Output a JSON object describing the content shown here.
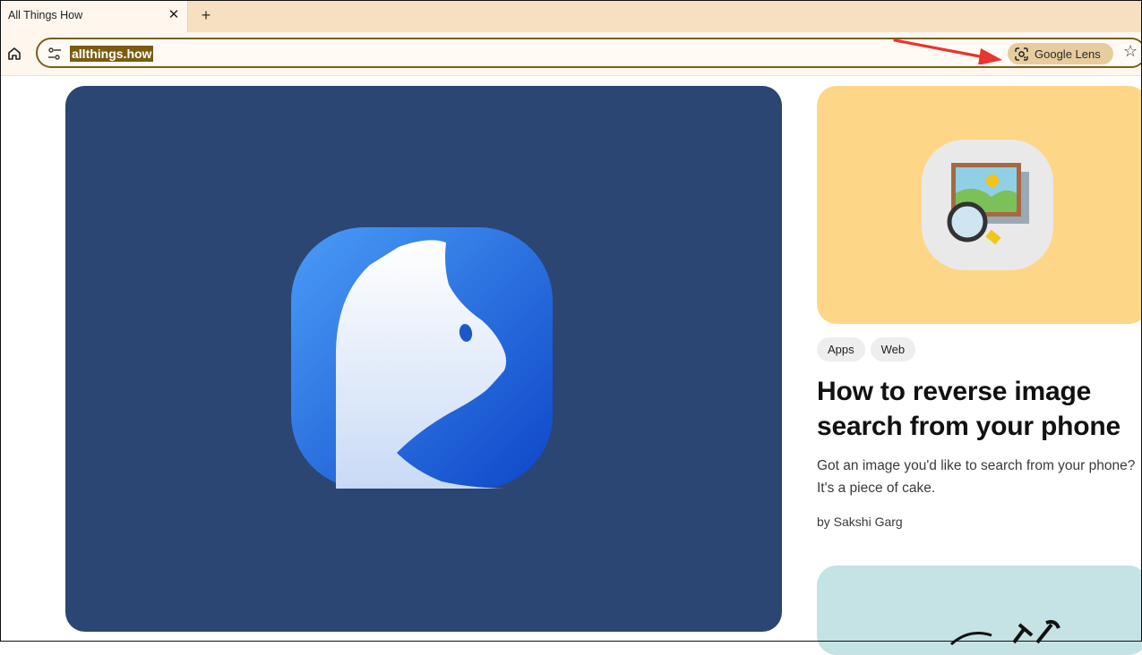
{
  "browser": {
    "tab_title": "All Things How",
    "tab_close": "✕",
    "new_tab": "+",
    "url": "allthings.how",
    "lens_label": "Google Lens",
    "star": "☆"
  },
  "hero": {
    "icon": "cat-app-icon"
  },
  "article": {
    "tags": [
      "Apps",
      "Web"
    ],
    "title": "How to reverse image search from your phone",
    "excerpt": "Got an image you'd like to search from your phone? It's a piece of cake.",
    "byline": "by Sakshi Garg"
  },
  "colors": {
    "tab_strip": "#f7e0c2",
    "omnibox_border": "#7c5e1e",
    "lens_chip": "#e7cc9e",
    "hero_bg": "#2b4673",
    "card_bg": "#fed687",
    "card2_bg": "#c5e2e4",
    "arrow": "#e8352f"
  }
}
